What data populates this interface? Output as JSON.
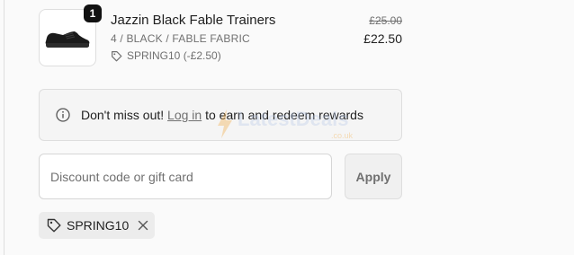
{
  "order_item": {
    "quantity": "1",
    "name": "Jazzin Black Fable Trainers",
    "variant": "4 / BLACK / FABLE FABRIC",
    "discount_code_applied": "SPRING10 (-£2.50)",
    "price_original": "£25.00",
    "price_final": "£22.50",
    "image_icon": "black-trainer-shoe"
  },
  "notice": {
    "icon": "info-icon",
    "prefix": "Don't miss out!",
    "link": "Log in",
    "suffix": "to earn and redeem rewards"
  },
  "watermark": {
    "text": "LatestDeals",
    "sub": ".co.uk"
  },
  "discount": {
    "placeholder": "Discount code or gift card",
    "value": "",
    "apply_label": "Apply"
  },
  "applied_code": {
    "code": "SPRING10",
    "icon": "tag-icon",
    "remove_icon": "close-icon"
  },
  "colors": {
    "badge_bg": "#111111",
    "muted_text": "#707070",
    "border": "#dedede",
    "chip_bg": "#ececec"
  }
}
